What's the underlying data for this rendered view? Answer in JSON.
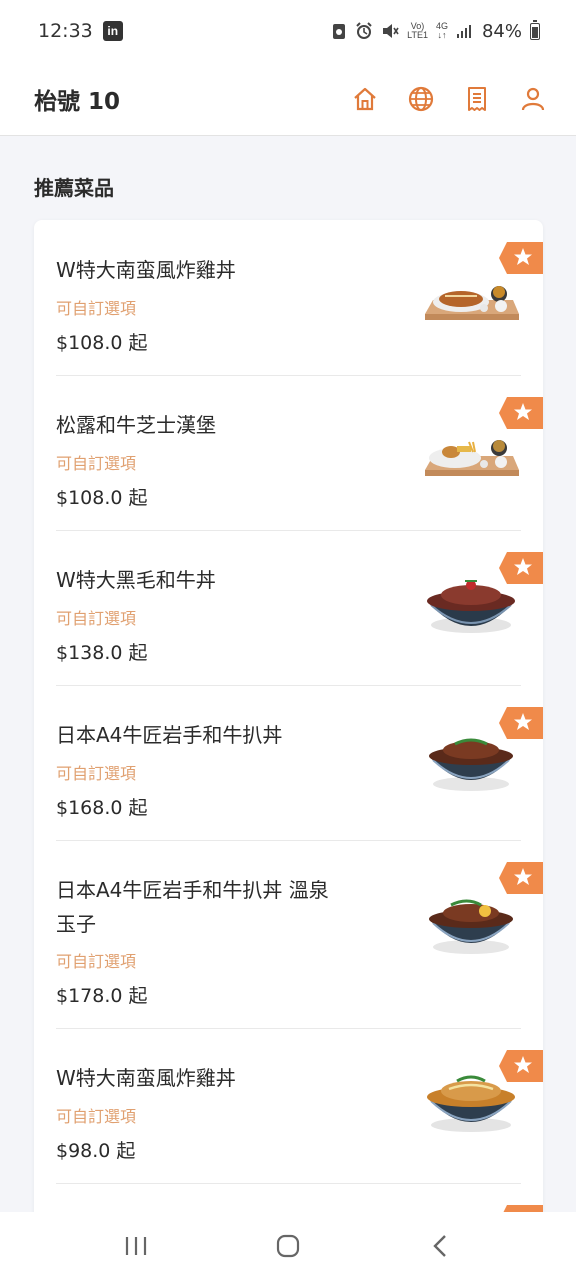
{
  "status_bar": {
    "time": "12:33",
    "app_badge": "in",
    "network_top": "Vo)",
    "network_bottom": "LTE1",
    "gen_label": "4G",
    "battery_text": "84%",
    "battery_level": 0.84
  },
  "header": {
    "title": "枱號 10",
    "icons": [
      "home-icon",
      "globe-icon",
      "receipt-icon",
      "user-icon"
    ]
  },
  "section": {
    "title": "推薦菜品"
  },
  "items": [
    {
      "name": "W特大南蛮風炸雞丼",
      "option": "可自訂選項",
      "price": "$108.0 起",
      "dish": "tray-set"
    },
    {
      "name": "松露和牛芝士漢堡",
      "option": "可自訂選項",
      "price": "$108.0 起",
      "dish": "tray-set"
    },
    {
      "name": "W特大黑毛和牛丼",
      "option": "可自訂選項",
      "price": "$138.0 起",
      "dish": "bowl"
    },
    {
      "name": "日本A4牛匠岩手和牛扒丼",
      "option": "可自訂選項",
      "price": "$168.0 起",
      "dish": "bowl"
    },
    {
      "name": "日本A4牛匠岩手和牛扒丼 溫泉玉子",
      "option": "可自訂選項",
      "price": "$178.0 起",
      "dish": "bowl"
    },
    {
      "name": "W特大南蛮風炸雞丼",
      "option": "可自訂選項",
      "price": "$98.0 起",
      "dish": "bowl"
    }
  ],
  "colors": {
    "accent": "#e07a3a",
    "option_text": "#e0a070",
    "background": "#f4f5f9"
  },
  "nav": [
    "recent-apps-icon",
    "home-button-icon",
    "back-icon"
  ]
}
